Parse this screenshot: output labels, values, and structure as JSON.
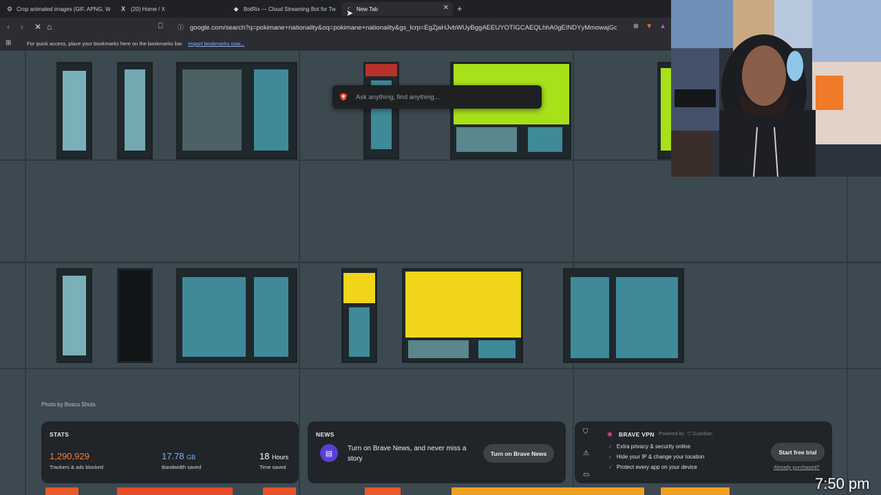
{
  "tabs": [
    {
      "title": "Crop animated images (GIF, APNG, W",
      "icon": "ezgif-icon"
    },
    {
      "title": "(20) Home / X",
      "icon": "x-icon"
    },
    {
      "title": "BotRix — Cloud Streaming Bot for Tw",
      "icon": "botrix-icon"
    },
    {
      "title": "New Tab",
      "icon": "loading-icon",
      "active": true
    }
  ],
  "toolbar": {
    "url": "google.com/search?q=pokimane+nationality&oq=pokimane+nationality&gs_lcrp=EgZjaHJvbWUyBggAEEUYOTIGCAEQLhhA0gEINDYyMmowajGoAg..."
  },
  "bookmarks_bar": {
    "message": "For quick access, place your bookmarks here on the bookmarks bar.",
    "import_link": "Import bookmarks now..."
  },
  "search": {
    "placeholder": "Ask anything, find anything..."
  },
  "photo_credit": "Photo by Bosco Shots",
  "stats": {
    "title": "STATS",
    "trackers_value": "1,290,929",
    "trackers_label": "Trackers & ads blocked",
    "bandwidth_value": "17.78",
    "bandwidth_unit": "GB",
    "bandwidth_label": "Bandwidth saved",
    "time_value": "18",
    "time_unit": "Hours",
    "time_label": "Time saved"
  },
  "news": {
    "title": "NEWS",
    "text": "Turn on Brave News, and never miss a story",
    "button": "Turn on Brave News"
  },
  "vpn": {
    "title": "BRAVE VPN",
    "powered": "Powered by",
    "partner": "Guardian",
    "features": [
      "Extra privacy & security online",
      "Hide your IP & change your location",
      "Protect every app on your device"
    ],
    "trial_button": "Start free trial",
    "purchased_link": "Already purchased?"
  },
  "clock": "7:50 pm",
  "colors": {
    "trackers": "#f0813a",
    "bandwidth": "#7bb3f0",
    "accent_green": "#a8e01a",
    "accent_yellow": "#f0d51a"
  }
}
